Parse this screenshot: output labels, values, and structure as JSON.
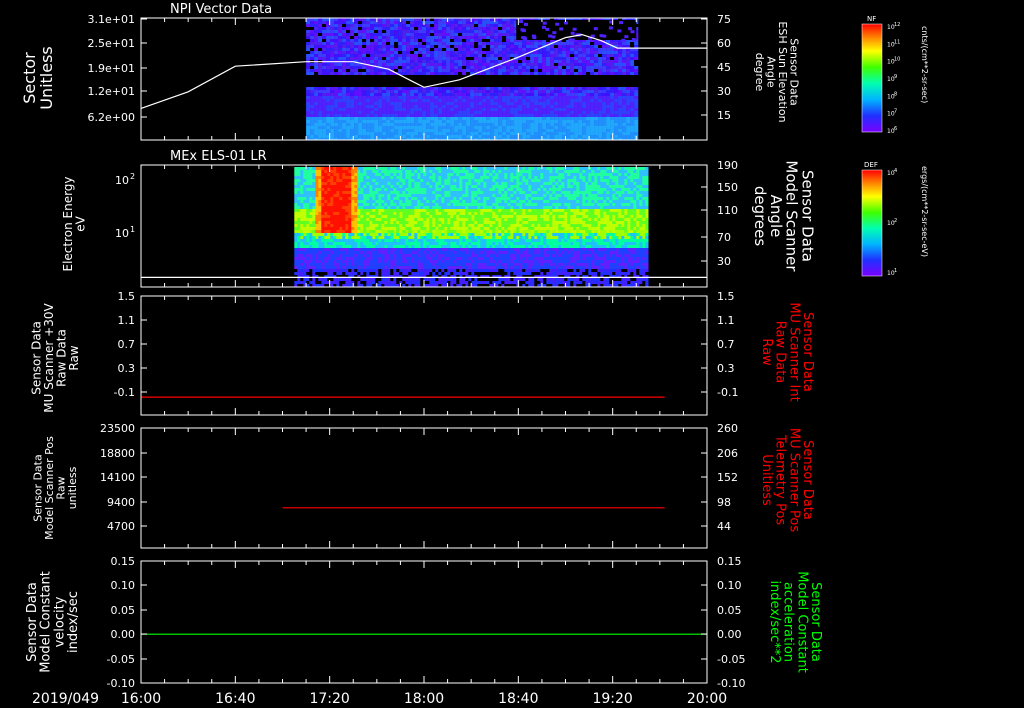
{
  "time_axis": {
    "date_label": "2019/049",
    "ticks": [
      "16:00",
      "16:40",
      "17:20",
      "18:00",
      "18:40",
      "19:20",
      "20:00"
    ],
    "range": [
      "16:00",
      "20:00"
    ]
  },
  "chart_data": [
    {
      "type": "heatmap",
      "title": "NPI Vector Data",
      "ylabel": "Sector\nUnitless",
      "yticks": [
        "3.1e+01",
        "2.5e+01",
        "1.9e+01",
        "1.2e+01",
        "6.2e+00"
      ],
      "y2label": "Sensor Data\nESH Sun Elevation\nAngle\ndegree",
      "y2ticks": [
        "75",
        "60",
        "45",
        "30",
        "15"
      ],
      "y2range": [
        0,
        75
      ],
      "data_coverage": [
        "17:10",
        "19:30"
      ],
      "colorbar": {
        "title": "NF",
        "units": "cnts/(cm**2-sr-sec)",
        "tick_labels": [
          "10^12",
          "10^11",
          "10^10",
          "10^9",
          "10^8",
          "10^7",
          "10^6"
        ]
      },
      "line": {
        "name": "ESH Sun Elevation",
        "color": "#ffffff",
        "points": [
          [
            "16:00",
            21
          ],
          [
            "16:20",
            32
          ],
          [
            "16:40",
            49
          ],
          [
            "17:10",
            52
          ],
          [
            "17:30",
            52
          ],
          [
            "17:45",
            47
          ],
          [
            "17:55",
            39
          ],
          [
            "18:00",
            35
          ],
          [
            "18:15",
            40
          ],
          [
            "18:40",
            55
          ],
          [
            "19:00",
            68
          ],
          [
            "19:07",
            70
          ],
          [
            "19:15",
            66
          ],
          [
            "19:22",
            61
          ],
          [
            "19:30",
            61
          ],
          [
            "20:00",
            61
          ]
        ]
      }
    },
    {
      "type": "heatmap",
      "title": "MEx ELS-01 LR",
      "ylabel": "Electron Energy\neV",
      "yticks": [
        "10^2",
        "10^1"
      ],
      "y2label": "Sensor Data\nModel Scanner\nAngle\ndegrees",
      "y2ticks": [
        "190",
        "150",
        "110",
        "70",
        "30"
      ],
      "y2range": [
        0,
        190
      ],
      "data_coverage": [
        "17:05",
        "19:35"
      ],
      "colorbar": {
        "title": "DEF",
        "units": "ergs/(cm**2-sr-sec-eV)",
        "tick_labels": [
          "10^4",
          "10^2",
          "10^1"
        ]
      },
      "line": {
        "name": "Model Scanner Angle",
        "color": "#ffffff",
        "points": [
          [
            "16:00",
            15
          ],
          [
            "20:00",
            15
          ]
        ]
      }
    },
    {
      "type": "line",
      "ylabel": "Sensor Data\nMU Scanner +30V\nRaw Data\nRaw",
      "yticks": [
        "1.5",
        "1.1",
        "0.7",
        "0.3",
        "-0.1"
      ],
      "ylim": [
        -0.3,
        1.5
      ],
      "y2label": "Sensor Data\nMU Scanner Int\nRaw Data\nRaw",
      "y2ticks": [
        "1.5",
        "1.1",
        "0.7",
        "0.3",
        "-0.1"
      ],
      "series": [
        {
          "color": "#ff0000",
          "points": [
            [
              "16:00",
              -0.03
            ],
            [
              "19:42",
              -0.03
            ]
          ]
        }
      ]
    },
    {
      "type": "line",
      "ylabel": "Sensor Data\nModel Scanner Pos\nRaw\nunitless",
      "yticks": [
        "23500",
        "18800",
        "14100",
        "9400",
        "4700"
      ],
      "ylim": [
        0,
        23500
      ],
      "y2label": "Sensor Data\nMU Scanner Pos\nTelemetry Pos\nUnitless",
      "y2ticks": [
        "260",
        "206",
        "152",
        "98",
        "44"
      ],
      "y2range": [
        0,
        260
      ],
      "series": [
        {
          "color": "#ff0000",
          "points": [
            [
              "17:00",
              87
            ],
            [
              "19:42",
              87
            ]
          ]
        }
      ]
    },
    {
      "type": "line",
      "ylabel": "Sensor Data\nModel Constant\nvelocity\nindex/sec",
      "yticks": [
        "0.15",
        "0.10",
        "0.05",
        "0.00",
        "-0.05",
        "-0.10"
      ],
      "ylim": [
        -0.1,
        0.15
      ],
      "y2label": "Sensor Data\nModel Constant\nacceleration\nindex/sec**2",
      "y2ticks": [
        "0.15",
        "0.10",
        "0.05",
        "0.00",
        "-0.05",
        "-0.10"
      ],
      "series": [
        {
          "color": "#00ff00",
          "points": [
            [
              "16:00",
              0
            ],
            [
              "20:00",
              0
            ]
          ]
        }
      ]
    }
  ]
}
